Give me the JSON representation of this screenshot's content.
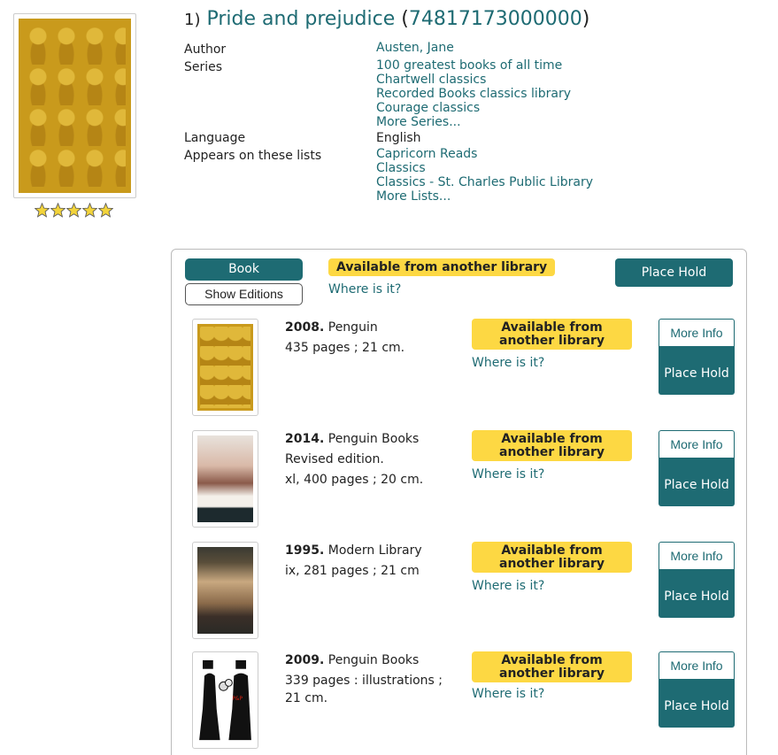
{
  "record": {
    "number": "1)",
    "title": "Pride and prejudice",
    "paren_open": "(",
    "isbn": "74817173000000",
    "paren_close": ")",
    "rating_stars": 5
  },
  "meta": {
    "author_label": "Author",
    "author": "Austen, Jane",
    "series_label": "Series",
    "series": [
      "100 greatest books of all time",
      "Chartwell classics",
      "Recorded Books classics library",
      "Courage classics",
      "More Series..."
    ],
    "language_label": "Language",
    "language": "English",
    "lists_label": "Appears on these lists",
    "lists": [
      "Capricorn Reads",
      "Classics",
      "Classics - St. Charles Public Library",
      "More Lists..."
    ]
  },
  "format": {
    "book_label": "Book",
    "show_editions_label": "Show Editions",
    "availability": "Available from another library",
    "where_label": "Where is it?",
    "place_hold_label": "Place Hold"
  },
  "editions": [
    {
      "year": "2008.",
      "publisher": "Penguin",
      "lines": [
        "435 pages ; 21 cm."
      ],
      "availability": "Available from another library",
      "where": "Where is it?",
      "more_info": "More Info",
      "place_hold": "Place Hold"
    },
    {
      "year": "2014.",
      "publisher": "Penguin Books",
      "lines": [
        "Revised edition.",
        "xl, 400 pages ; 20 cm."
      ],
      "availability": "Available from another library",
      "where": "Where is it?",
      "more_info": "More Info",
      "place_hold": "Place Hold"
    },
    {
      "year": "1995.",
      "publisher": "Modern Library",
      "lines": [
        "ix, 281 pages ; 21 cm"
      ],
      "availability": "Available from another library",
      "where": "Where is it?",
      "more_info": "More Info",
      "place_hold": "Place Hold"
    },
    {
      "year": "2009.",
      "publisher": "Penguin Books",
      "lines": [
        "339 pages : illustrations ; 21 cm."
      ],
      "availability": "Available from another library",
      "where": "Where is it?",
      "more_info": "More Info",
      "place_hold": "Place Hold"
    }
  ],
  "colors": {
    "accent": "#1e6b73",
    "availability": "#fdd843",
    "cover_gold": "#c99a1c"
  }
}
